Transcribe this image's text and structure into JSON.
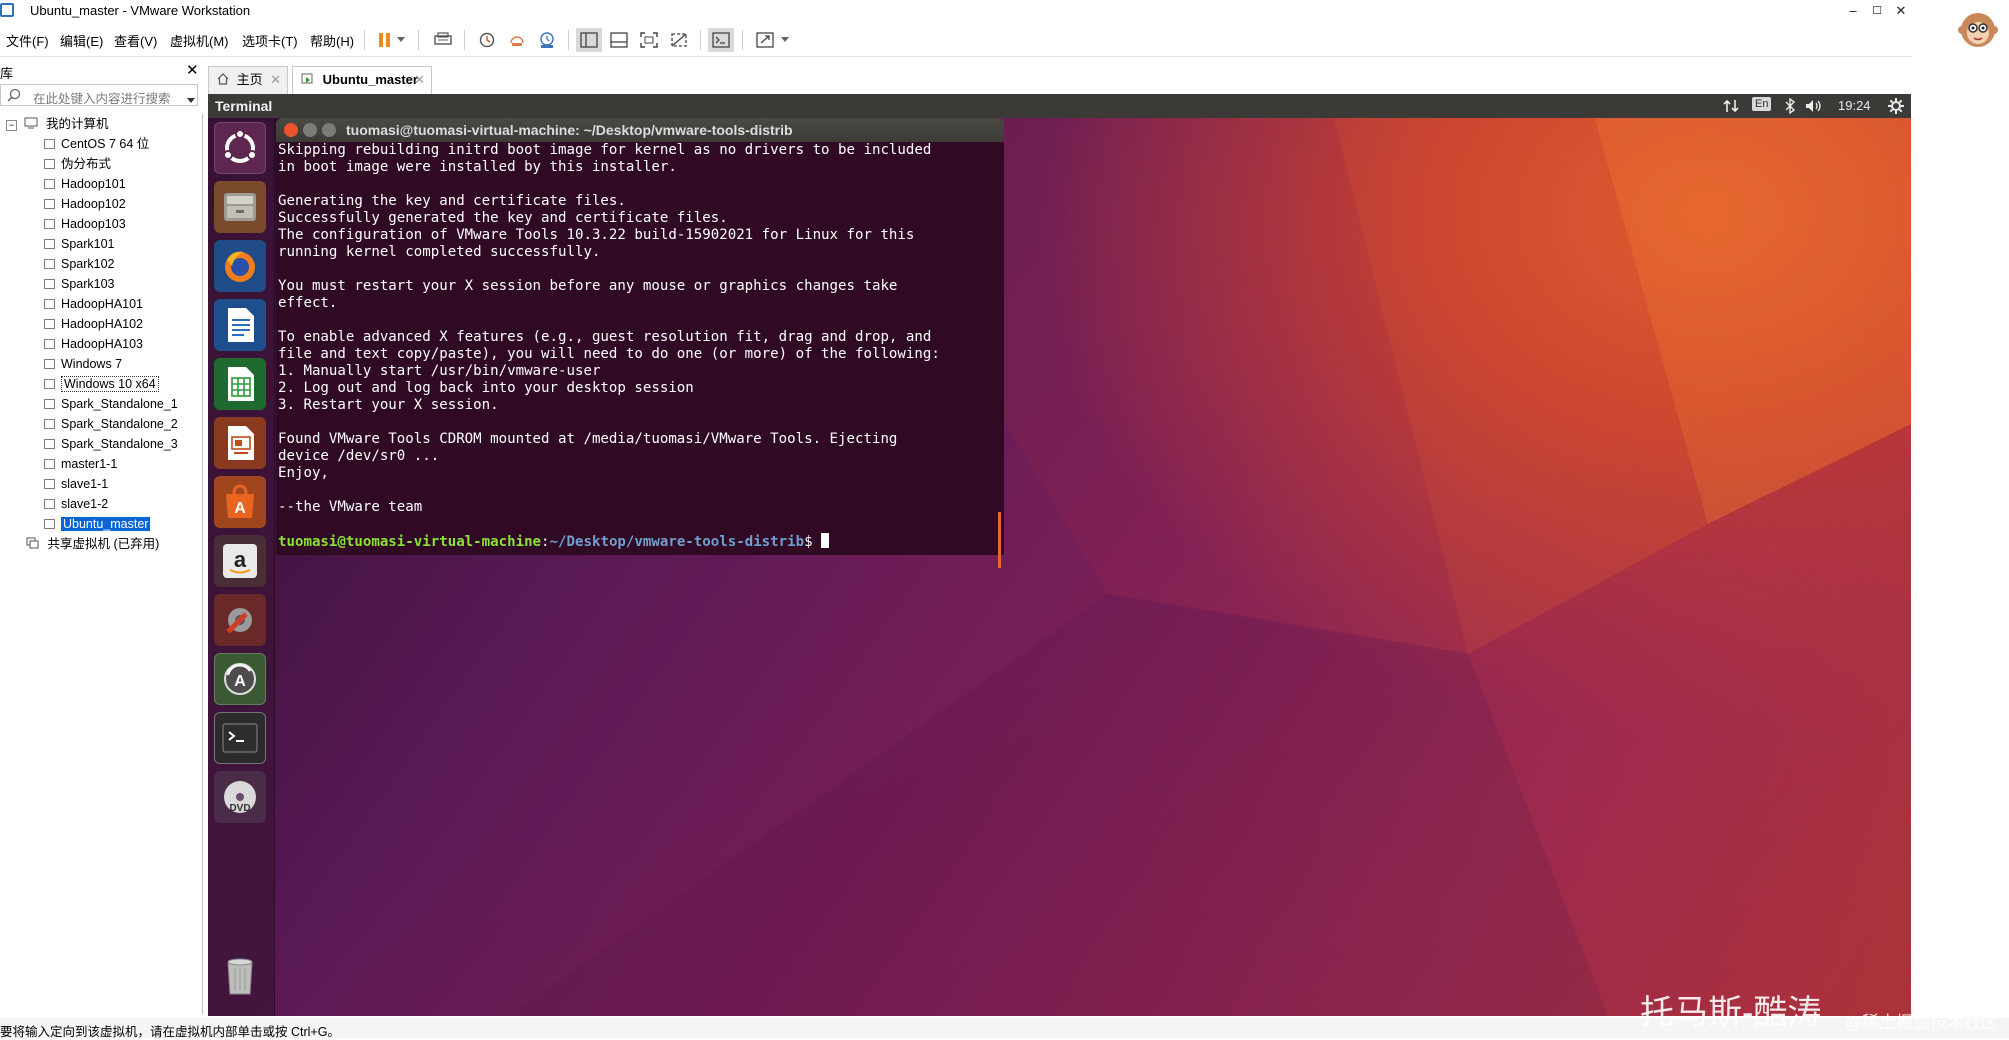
{
  "window": {
    "title": "Ubuntu_master - VMware Workstation",
    "controls": [
      "–",
      "☐",
      "✕"
    ]
  },
  "menubar": {
    "items": [
      "文件(F)",
      "编辑(E)",
      "查看(V)",
      "虚拟机(M)",
      "选项卡(T)",
      "帮助(H)"
    ]
  },
  "library": {
    "title": "库",
    "close": "✕",
    "search_placeholder": "在此处键入内容进行搜索",
    "root": "我的计算机",
    "vms": [
      "CentOS 7 64 位",
      "伪分布式",
      "Hadoop101",
      "Hadoop102",
      "Hadoop103",
      "Spark101",
      "Spark102",
      "Spark103",
      "HadoopHA101",
      "HadoopHA102",
      "HadoopHA103",
      "Windows 7",
      "Windows 10 x64",
      "Spark_Standalone_1",
      "Spark_Standalone_2",
      "Spark_Standalone_3",
      "master1-1",
      "slave1-1",
      "slave1-2",
      "Ubuntu_master"
    ],
    "selected": "Ubuntu_master",
    "shared": "共享虚拟机 (已弃用)"
  },
  "tabs": [
    {
      "label": "主页"
    },
    {
      "label": "Ubuntu_master"
    }
  ],
  "guest": {
    "topbar_title": "Terminal",
    "tray": {
      "lang": "En",
      "time": "19:24"
    },
    "terminal": {
      "title": "tuomasi@tuomasi-virtual-machine: ~/Desktop/vmware-tools-distrib",
      "lines": [
        "Skipping rebuilding initrd boot image for kernel as no drivers to be included",
        "in boot image were installed by this installer.",
        "",
        "Generating the key and certificate files.",
        "Successfully generated the key and certificate files.",
        "The configuration of VMware Tools 10.3.22 build-15902021 for Linux for this",
        "running kernel completed successfully.",
        "",
        "You must restart your X session before any mouse or graphics changes take",
        "effect.",
        "",
        "To enable advanced X features (e.g., guest resolution fit, drag and drop, and",
        "file and text copy/paste), you will need to do one (or more) of the following:",
        "1. Manually start /usr/bin/vmware-user",
        "2. Log out and log back into your desktop session",
        "3. Restart your X session.",
        "",
        "Found VMware Tools CDROM mounted at /media/tuomasi/VMware Tools. Ejecting",
        "device /dev/sr0 ...",
        "Enjoy,",
        "",
        "--the VMware team",
        ""
      ],
      "prompt_user": "tuomasi@tuomasi-virtual-machine",
      "prompt_sep": ":",
      "prompt_path": "~/Desktop/vmware-tools-distrib",
      "prompt_end": "$ "
    }
  },
  "statusbar": {
    "text": "要将输入定向到该虚拟机，请在虚拟机内部单击或按 Ctrl+G。"
  },
  "watermark": {
    "main": "托马斯-酷涛",
    "sub": "@稀土掘金技术社区"
  }
}
